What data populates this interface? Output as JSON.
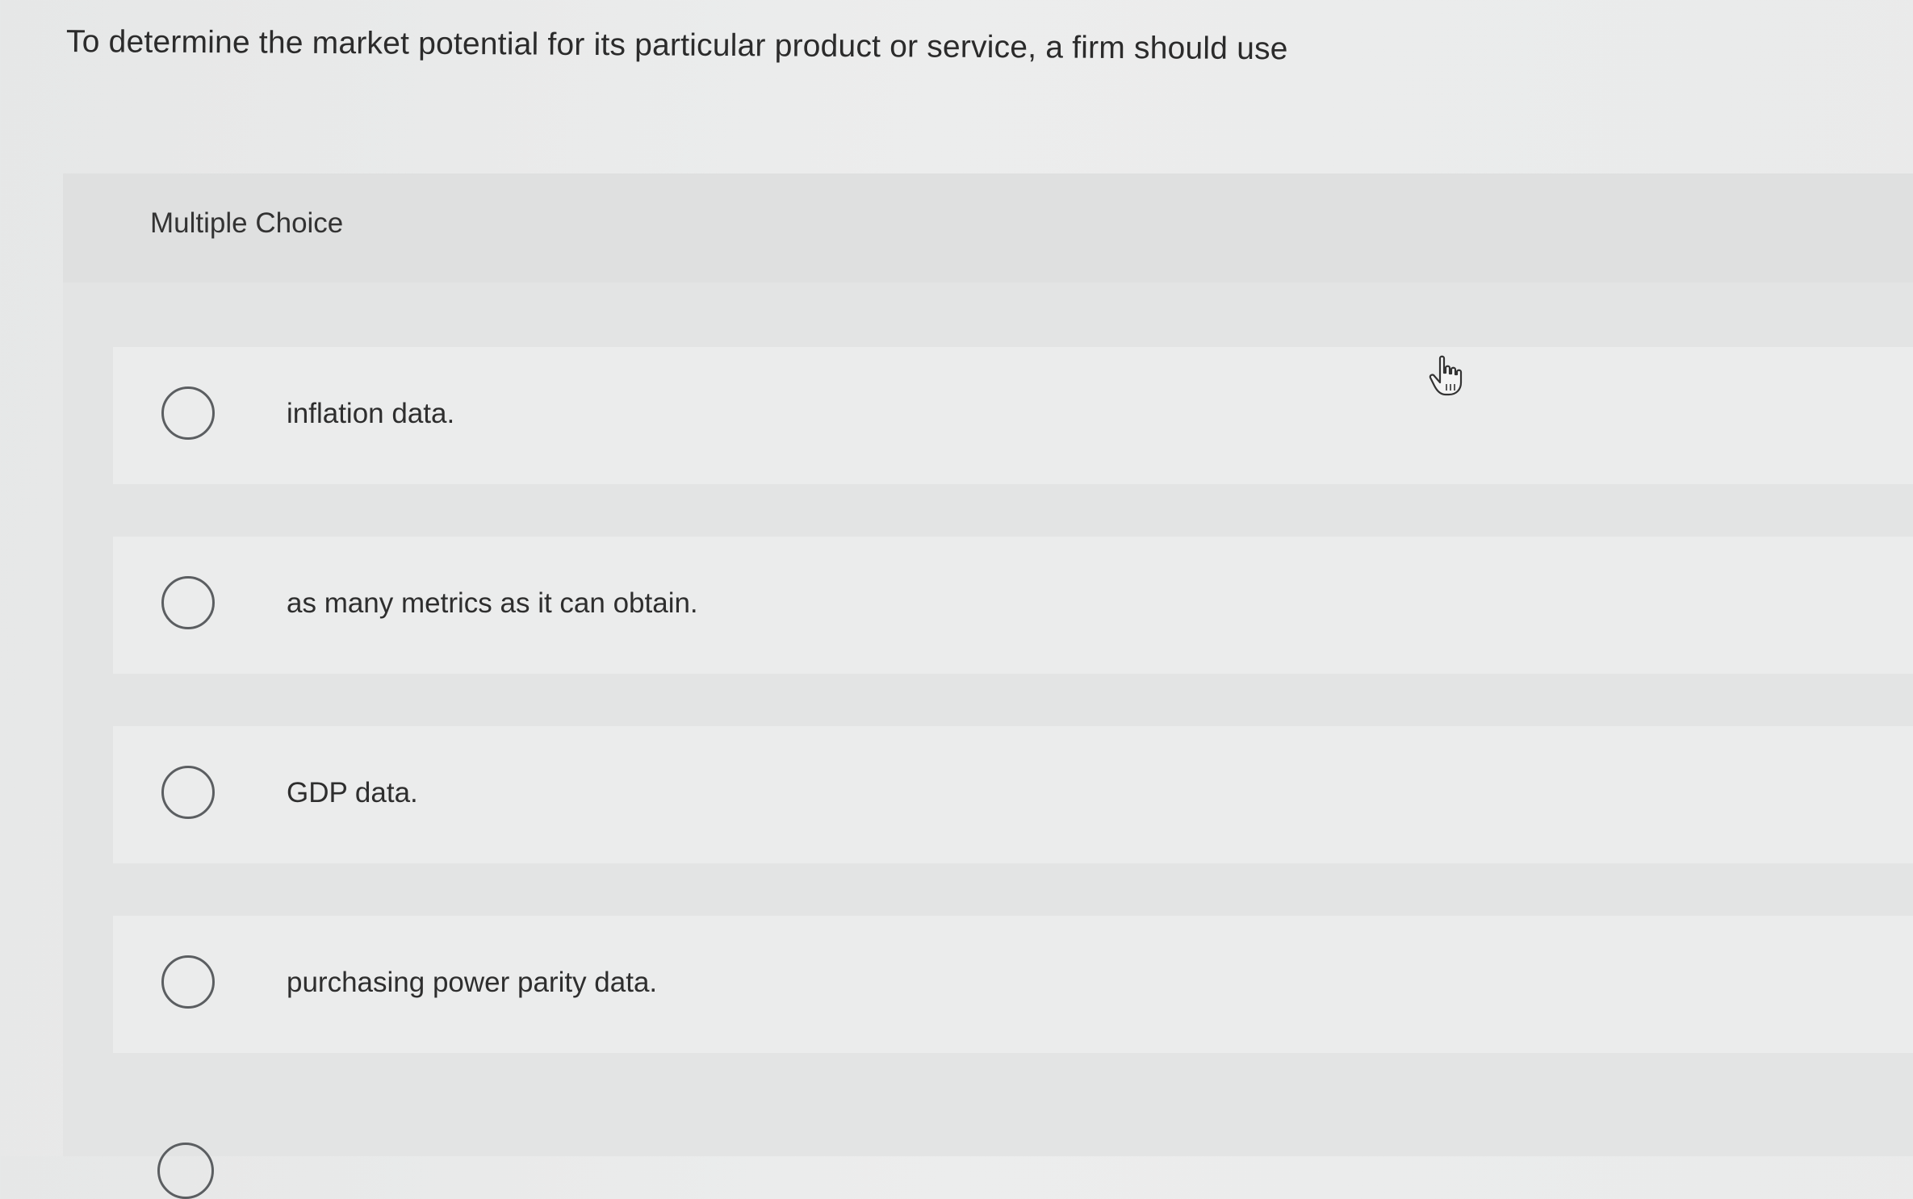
{
  "question": {
    "text": "To determine the market potential for its particular product or service, a firm should use"
  },
  "panel": {
    "type_label": "Multiple Choice",
    "choices": [
      {
        "label": "inflation data."
      },
      {
        "label": "as many metrics as it can obtain."
      },
      {
        "label": "GDP data."
      },
      {
        "label": "purchasing power parity data."
      }
    ]
  },
  "icons": {
    "cursor": "hand-pointer-icon",
    "radio": "radio-unselected-icon"
  },
  "colors": {
    "background": "#ebecec",
    "panel": "#e3e4e4",
    "text": "#2b2b2b",
    "radio_border": "#5b5e61"
  }
}
